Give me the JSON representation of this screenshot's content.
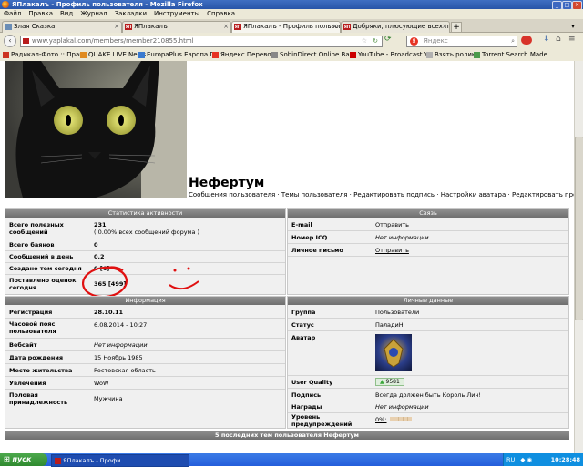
{
  "window": {
    "title": "ЯПлакалъ - Профиль пользователя - Mozilla Firefox",
    "controls": [
      "_",
      "□",
      "×"
    ]
  },
  "menu": [
    "Файл",
    "Правка",
    "Вид",
    "Журнал",
    "Закладки",
    "Инструменты",
    "Справка"
  ],
  "tabs": [
    {
      "label": "Злая Сказка",
      "active": false
    },
    {
      "label": "ЯПлакалъ",
      "active": false
    },
    {
      "label": "ЯПлакалъ - Профиль пользовате...",
      "active": true
    },
    {
      "label": "Добряки, плюсующие всех подр...",
      "active": false
    }
  ],
  "nav": {
    "url": "www.yaplakal.com/members/member210855.html",
    "search_placeholder": "Яндекс"
  },
  "bookmarks": [
    {
      "label": "Радикал-Фото :: Прав...",
      "color": "#cc3322"
    },
    {
      "label": "QUAKE LIVE News",
      "color": "#e08a20"
    },
    {
      "label": "EuropaPlus Европа Пл...",
      "color": "#3a7ad0"
    },
    {
      "label": "Яндекс.Перевод",
      "color": "#e63323"
    },
    {
      "label": "SobinDirect Online Ban...",
      "color": "#888888"
    },
    {
      "label": "YouTube - Broadcast Y...",
      "color": "#cc0000"
    },
    {
      "label": "Взять ролик!",
      "color": "#b0b0b0"
    },
    {
      "label": "Torrent Search Made ...",
      "color": "#4a9a4a"
    }
  ],
  "profile": {
    "username": "Нефертум",
    "links": [
      "Сообщения пользователя",
      "Темы пользователя",
      "Редактировать подпись",
      "Настройки аватара",
      "Редактировать профиль"
    ],
    "separator": " · "
  },
  "activity": {
    "header": "Статистика активности",
    "rows": [
      {
        "label": "Всего полезных сообщений",
        "value": "231",
        "sub": "( 0.00% всех сообщений форума )"
      },
      {
        "label": "Всего баянов",
        "value": "0"
      },
      {
        "label": "Сообщений в день",
        "value": "0.2"
      },
      {
        "label": "Создано тем сегодня",
        "value": "0 [6]"
      },
      {
        "label": "Поставлено оценок сегодня",
        "value": "365 [499]"
      }
    ]
  },
  "contact": {
    "header": "Связь",
    "rows": [
      {
        "label": "E-mail",
        "value": "Отправить",
        "style": "link"
      },
      {
        "label": "Номер ICQ",
        "value": "Нет информации",
        "style": "italic"
      },
      {
        "label": "Личное письмо",
        "value": "Отправить",
        "style": "link"
      }
    ]
  },
  "info": {
    "header": "Информация",
    "rows": [
      {
        "label": "Регистрация",
        "value": "28.10.11",
        "bold": true
      },
      {
        "label": "Часовой пояс пользователя",
        "value": "6.08.2014 - 10:27"
      },
      {
        "label": "Вебсайт",
        "value": "Нет информации",
        "style": "italic"
      },
      {
        "label": "Дата рождения",
        "value": "15 Ноябрь 1985"
      },
      {
        "label": "Место жительства",
        "value": "Ростовская область"
      },
      {
        "label": "Увлечения",
        "value": "WoW"
      },
      {
        "label": "Половая принадлежность",
        "value": "Мужчина"
      }
    ]
  },
  "personal": {
    "header": "Личные данные",
    "rows": [
      {
        "label": "Группа",
        "value": "Пользователи"
      },
      {
        "label": "Статус",
        "value": "ПаладиН"
      },
      {
        "label": "Аватар",
        "value": ""
      },
      {
        "label": "User Quality",
        "value": "9581"
      },
      {
        "label": "Подпись",
        "value": "Всегда должен быть Король Лич!"
      },
      {
        "label": "Награды",
        "value": "Нет информации",
        "style": "italic"
      },
      {
        "label": "Уровень предупреждений",
        "value": "0%:"
      }
    ]
  },
  "footer_bar": "5 последних тем пользователя Нефертум",
  "taskbar": {
    "start": "пуск",
    "item": "ЯПлакалъ - Профи...",
    "lang": "RU",
    "clock": "10:28:48"
  },
  "colors": {
    "accent_red": "#e01010",
    "panel_header": "#7a7a7a",
    "quality_green": "#3aa83a"
  }
}
